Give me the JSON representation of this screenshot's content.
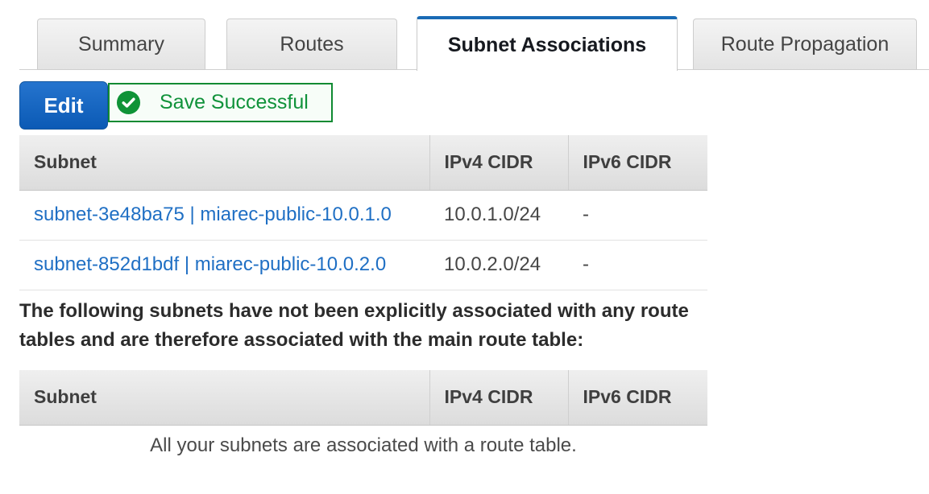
{
  "tabs": [
    {
      "label": "Summary",
      "active": false
    },
    {
      "label": "Routes",
      "active": false
    },
    {
      "label": "Subnet Associations",
      "active": true
    },
    {
      "label": "Route Propagation",
      "active": false
    }
  ],
  "toolbar": {
    "edit_label": "Edit",
    "notification": {
      "icon": "check-circle-icon",
      "text": "Save Successful",
      "border_color": "#108a32",
      "text_color": "#10923a",
      "background_color": "#f7fdf8"
    },
    "edit_button_color": "#0b5ab5"
  },
  "associated_table": {
    "columns": [
      "Subnet",
      "IPv4 CIDR",
      "IPv6 CIDR"
    ],
    "rows": [
      {
        "subnet": "subnet-3e48ba75 | miarec-public-10.0.1.0",
        "ipv4_cidr": "10.0.1.0/24",
        "ipv6_cidr": "-"
      },
      {
        "subnet": "subnet-852d1bdf | miarec-public-10.0.2.0",
        "ipv4_cidr": "10.0.2.0/24",
        "ipv6_cidr": "-"
      }
    ],
    "link_color": "#1f6fc4"
  },
  "note": "The following subnets have not been explicitly associated with any route tables and are therefore associated with the main route table:",
  "unassociated_table": {
    "columns": [
      "Subnet",
      "IPv4 CIDR",
      "IPv6 CIDR"
    ],
    "rows": [],
    "empty_message": "All your subnets are associated with a route table."
  }
}
